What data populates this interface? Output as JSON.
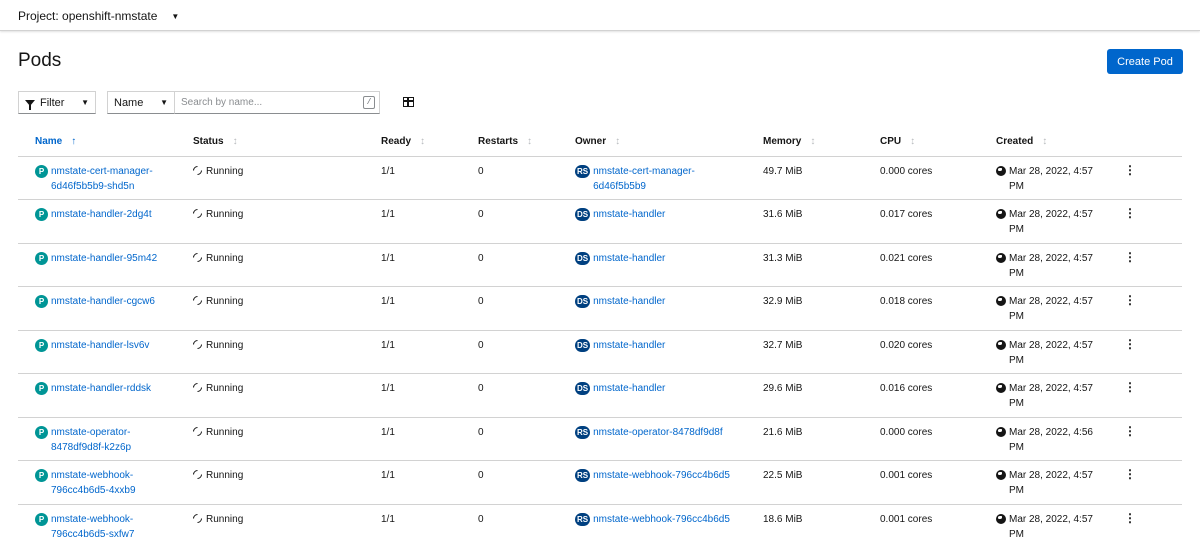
{
  "project_bar": {
    "label": "Project: openshift-nmstate"
  },
  "page": {
    "title": "Pods",
    "create_button": "Create Pod"
  },
  "toolbar": {
    "filter_label": "Filter",
    "name_dropdown": "Name",
    "search_placeholder": "Search by name...",
    "search_value": "",
    "search_hint": "/"
  },
  "columns": [
    {
      "label": "Name",
      "sorted": true
    },
    {
      "label": "Status"
    },
    {
      "label": "Ready"
    },
    {
      "label": "Restarts"
    },
    {
      "label": "Owner"
    },
    {
      "label": "Memory"
    },
    {
      "label": "CPU"
    },
    {
      "label": "Created"
    }
  ],
  "pod_badge": "P",
  "rows": [
    {
      "name_l1": "nmstate-cert-manager-",
      "name_l2": "6d46f5b5b9-shd5n",
      "status": "Running",
      "ready": "1/1",
      "restarts": "0",
      "owner_kind": "RS",
      "owner_l1": "nmstate-cert-manager-",
      "owner_l2": "6d46f5b5b9",
      "memory": "49.7 MiB",
      "cpu": "0.000 cores",
      "created_l1": "Mar 28, 2022, 4:57",
      "created_l2": "PM"
    },
    {
      "name_l1": "nmstate-handler-2dg4t",
      "name_l2": "",
      "status": "Running",
      "ready": "1/1",
      "restarts": "0",
      "owner_kind": "DS",
      "owner_l1": "nmstate-handler",
      "owner_l2": "",
      "memory": "31.6 MiB",
      "cpu": "0.017 cores",
      "created_l1": "Mar 28, 2022, 4:57",
      "created_l2": "PM"
    },
    {
      "name_l1": "nmstate-handler-95m42",
      "name_l2": "",
      "status": "Running",
      "ready": "1/1",
      "restarts": "0",
      "owner_kind": "DS",
      "owner_l1": "nmstate-handler",
      "owner_l2": "",
      "memory": "31.3 MiB",
      "cpu": "0.021 cores",
      "created_l1": "Mar 28, 2022, 4:57",
      "created_l2": "PM"
    },
    {
      "name_l1": "nmstate-handler-cgcw6",
      "name_l2": "",
      "status": "Running",
      "ready": "1/1",
      "restarts": "0",
      "owner_kind": "DS",
      "owner_l1": "nmstate-handler",
      "owner_l2": "",
      "memory": "32.9 MiB",
      "cpu": "0.018 cores",
      "created_l1": "Mar 28, 2022, 4:57",
      "created_l2": "PM"
    },
    {
      "name_l1": "nmstate-handler-lsv6v",
      "name_l2": "",
      "status": "Running",
      "ready": "1/1",
      "restarts": "0",
      "owner_kind": "DS",
      "owner_l1": "nmstate-handler",
      "owner_l2": "",
      "memory": "32.7 MiB",
      "cpu": "0.020 cores",
      "created_l1": "Mar 28, 2022, 4:57",
      "created_l2": "PM"
    },
    {
      "name_l1": "nmstate-handler-rddsk",
      "name_l2": "",
      "status": "Running",
      "ready": "1/1",
      "restarts": "0",
      "owner_kind": "DS",
      "owner_l1": "nmstate-handler",
      "owner_l2": "",
      "memory": "29.6 MiB",
      "cpu": "0.016 cores",
      "created_l1": "Mar 28, 2022, 4:57",
      "created_l2": "PM"
    },
    {
      "name_l1": "nmstate-operator-",
      "name_l2": "8478df9d8f-k2z6p",
      "status": "Running",
      "ready": "1/1",
      "restarts": "0",
      "owner_kind": "RS",
      "owner_l1": "nmstate-operator-8478df9d8f",
      "owner_l2": "",
      "memory": "21.6 MiB",
      "cpu": "0.000 cores",
      "created_l1": "Mar 28, 2022, 4:56",
      "created_l2": "PM"
    },
    {
      "name_l1": "nmstate-webhook-",
      "name_l2": "796cc4b6d5-4xxb9",
      "status": "Running",
      "ready": "1/1",
      "restarts": "0",
      "owner_kind": "RS",
      "owner_l1": "nmstate-webhook-796cc4b6d5",
      "owner_l2": "",
      "memory": "22.5 MiB",
      "cpu": "0.001 cores",
      "created_l1": "Mar 28, 2022, 4:57",
      "created_l2": "PM"
    },
    {
      "name_l1": "nmstate-webhook-",
      "name_l2": "796cc4b6d5-sxfw7",
      "status": "Running",
      "ready": "1/1",
      "restarts": "0",
      "owner_kind": "RS",
      "owner_l1": "nmstate-webhook-796cc4b6d5",
      "owner_l2": "",
      "memory": "18.6 MiB",
      "cpu": "0.001 cores",
      "created_l1": "Mar 28, 2022, 4:57",
      "created_l2": "PM"
    }
  ]
}
